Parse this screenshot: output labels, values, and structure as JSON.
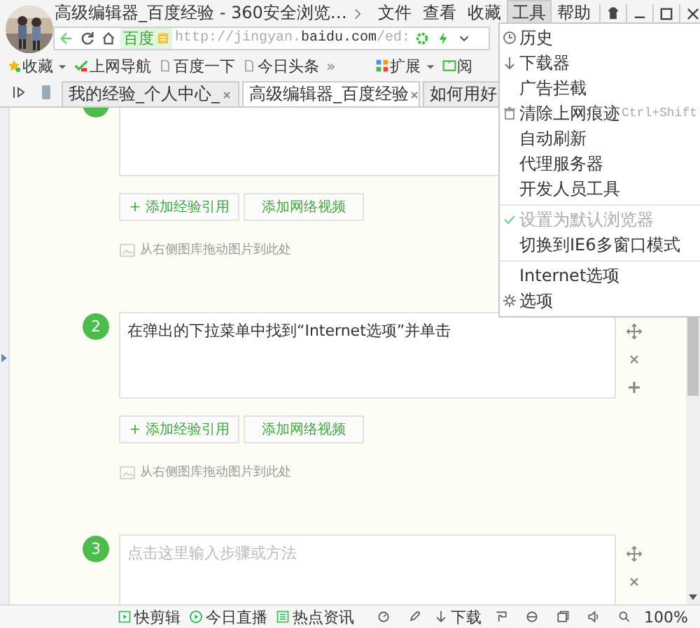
{
  "window": {
    "title": "高级编辑器_百度经验 - 360安全浏览…",
    "menus": [
      {
        "label": "文件",
        "selected": false
      },
      {
        "label": "查看",
        "selected": false
      },
      {
        "label": "收藏",
        "selected": false
      },
      {
        "label": "工具",
        "selected": true
      },
      {
        "label": "帮助",
        "selected": false
      }
    ]
  },
  "address_bar": {
    "site_badge": "百度",
    "url": "http://jingyan.**baidu.com**/ed:"
  },
  "bookmarks": [
    {
      "label": "收藏",
      "kind": "star",
      "dropdown": true
    },
    {
      "label": "上网导航",
      "kind": "nav",
      "dropdown": false
    },
    {
      "label": "百度一下",
      "kind": "page",
      "dropdown": false
    },
    {
      "label": "今日头条",
      "kind": "page",
      "dropdown": false
    },
    {
      "label": "»",
      "kind": "more"
    },
    {
      "label": "扩展",
      "kind": "apps",
      "dropdown": true
    },
    {
      "label": "阅",
      "kind": "book",
      "dropdown": false
    }
  ],
  "tabs": [
    {
      "label": "我的经验_个人中心_",
      "selected": false
    },
    {
      "label": "高级编辑器_百度经验",
      "selected": true
    },
    {
      "label": "如何用好",
      "selected": false
    }
  ],
  "steps": [
    {
      "buttons": [
        "+ 添加经验引用",
        "添加网络视频"
      ],
      "image_hint": "从右侧图库拖动图片到此处"
    },
    {
      "number": "2",
      "text": "在弹出的下拉菜单中找到“Internet选项”并单击",
      "buttons": [
        "+ 添加经验引用",
        "添加网络视频"
      ],
      "image_hint": "从右侧图库拖动图片到此处"
    },
    {
      "number": "3",
      "placeholder": "点击这里输入步骤或方法"
    }
  ],
  "status_bar": {
    "items": [
      {
        "label": "快剪辑",
        "kind": "clip"
      },
      {
        "label": "今日直播",
        "kind": "live"
      },
      {
        "label": "热点资讯",
        "kind": "news"
      }
    ],
    "download": "下载",
    "zoom": "100%"
  },
  "tools_menu": {
    "groups": [
      {
        "items": [
          {
            "label": "历史",
            "kind": "history",
            "checked": false,
            "disabled": false
          },
          {
            "label": "下载器",
            "kind": "download",
            "checked": false,
            "disabled": false
          },
          {
            "label": "广告拦截",
            "kind": "none",
            "checked": false,
            "disabled": false
          },
          {
            "label": "清除上网痕迹",
            "kind": "trash",
            "shortcut": "Ctrl+Shift",
            "checked": false,
            "disabled": false
          },
          {
            "label": "自动刷新",
            "kind": "none",
            "checked": false,
            "disabled": false
          },
          {
            "label": "代理服务器",
            "kind": "none",
            "checked": false,
            "disabled": false
          },
          {
            "label": "开发人员工具",
            "kind": "none",
            "checked": false,
            "disabled": false
          }
        ]
      },
      {
        "items": [
          {
            "label": "设置为默认浏览器",
            "kind": "none",
            "checked": true,
            "disabled": true
          },
          {
            "label": "切换到IE6多窗口模式",
            "kind": "none",
            "checked": false,
            "disabled": false
          }
        ]
      },
      {
        "items": [
          {
            "label": "Internet选项",
            "kind": "none",
            "checked": false,
            "disabled": false
          },
          {
            "label": "选项",
            "kind": "gear",
            "checked": false,
            "disabled": false
          }
        ]
      }
    ]
  }
}
